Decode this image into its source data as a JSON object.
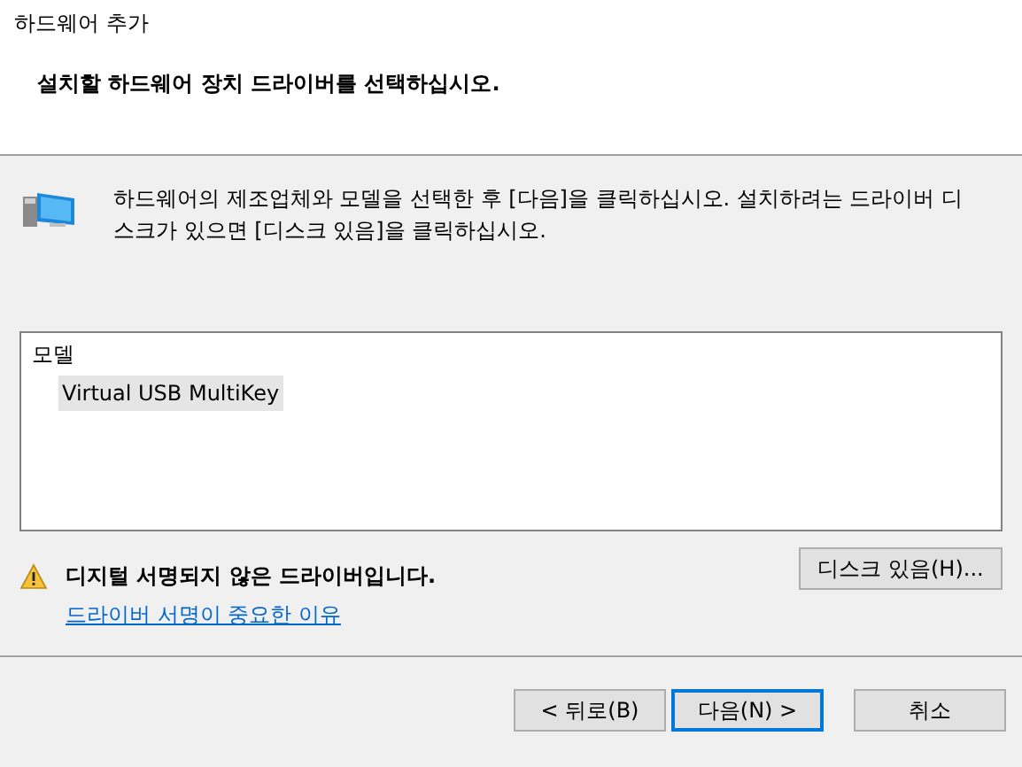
{
  "window": {
    "title": "하드웨어 추가"
  },
  "header": {
    "heading": "설치할 하드웨어 장치 드라이버를 선택하십시오."
  },
  "instruction": "하드웨어의 제조업체와 모델을 선택한 후 [다음]을 클릭하십시오. 설치하려는 드라이버 디스크가 있으면 [디스크 있음]을 클릭하십시오.",
  "model_list": {
    "heading": "모델",
    "items": [
      {
        "label": "Virtual USB MultiKey",
        "selected": true
      }
    ]
  },
  "warning": {
    "text": "디지털 서명되지 않은 드라이버입니다.",
    "link": "드라이버 서명이 중요한 이유"
  },
  "have_disk_button": "디스크 있음(H)...",
  "buttons": [
    {
      "label": "< 뒤로(B)",
      "default": false
    },
    {
      "label": "다음(N) >",
      "default": true
    },
    {
      "label": "취소",
      "default": false
    }
  ]
}
